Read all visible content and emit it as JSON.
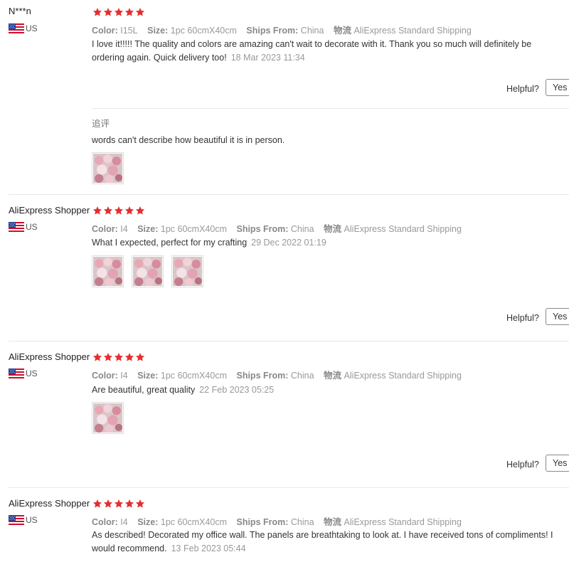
{
  "labels": {
    "color": "Color:",
    "size": "Size:",
    "ships_from": "Ships From:",
    "logistics": "物流",
    "helpful": "Helpful?",
    "yes": "Yes (",
    "followup": "追评"
  },
  "colors": {
    "star": "#e62e2e",
    "accent": "#e62e2e"
  },
  "reviews": [
    {
      "user": "N***n",
      "country": "US",
      "rating": 5,
      "color": "I15L",
      "size": "1pc 60cmX40cm",
      "ships_from": "China",
      "shipping": "AliExpress Standard Shipping",
      "text": "I love it!!!!! The quality and colors are amazing can't wait to decorate with it. Thank you so much will definitely be ordering again. Quick delivery too!",
      "date": "18 Mar 2023 11:34",
      "followup_text": "words can't describe how beautiful it is in person.",
      "followup_images": 1
    },
    {
      "user": "AliExpress Shopper",
      "country": "US",
      "rating": 5,
      "color": "I4",
      "size": "1pc 60cmX40cm",
      "ships_from": "China",
      "shipping": "AliExpress Standard Shipping",
      "text": "What I expected, perfect for my crafting",
      "date": "29 Dec 2022 01:19",
      "images": 3
    },
    {
      "user": "AliExpress Shopper",
      "country": "US",
      "rating": 5,
      "color": "I4",
      "size": "1pc 60cmX40cm",
      "ships_from": "China",
      "shipping": "AliExpress Standard Shipping",
      "text": "Are beautiful, great quality",
      "date": "22 Feb 2023 05:25",
      "images": 1
    },
    {
      "user": "AliExpress Shopper",
      "country": "US",
      "rating": 5,
      "color": "I4",
      "size": "1pc 60cmX40cm",
      "ships_from": "China",
      "shipping": "AliExpress Standard Shipping",
      "text": "As described! Decorated my office wall. The panels are breathtaking to look at. I have received tons of compliments! I would recommend.",
      "date": "13 Feb 2023 05:44"
    }
  ]
}
